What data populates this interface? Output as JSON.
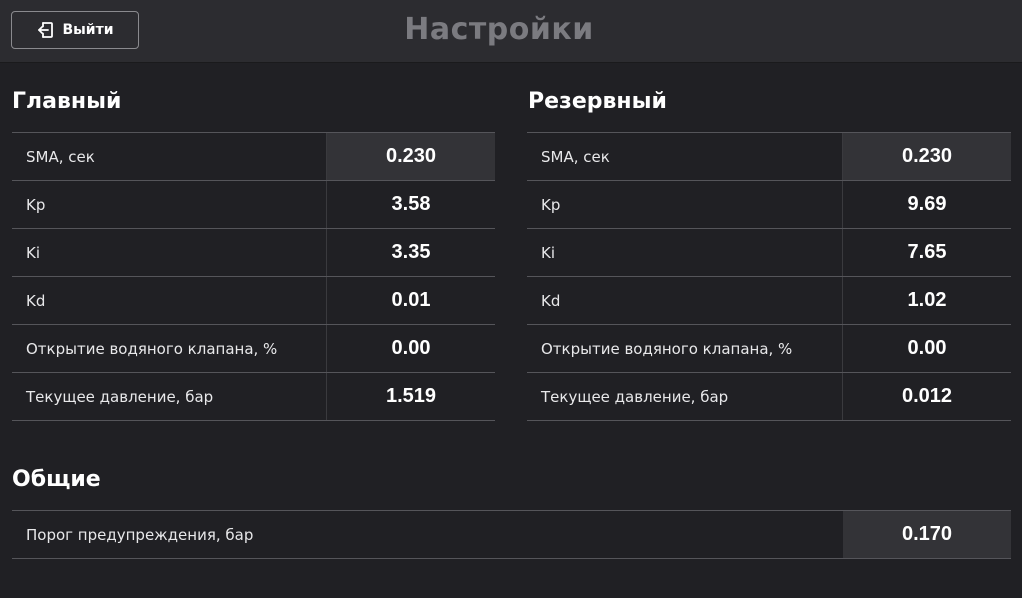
{
  "header": {
    "exit_label": "Выйти",
    "title": "Настройки"
  },
  "main_section": {
    "title": "Главный",
    "rows": [
      {
        "label": "SMA, сек",
        "value": "0.230"
      },
      {
        "label": "Kp",
        "value": "3.58"
      },
      {
        "label": "Ki",
        "value": "3.35"
      },
      {
        "label": "Kd",
        "value": "0.01"
      },
      {
        "label": "Открытие водяного клапана, %",
        "value": "0.00"
      },
      {
        "label": "Текущее давление, бар",
        "value": "1.519"
      }
    ]
  },
  "reserve_section": {
    "title": "Резервный",
    "rows": [
      {
        "label": "SMA, сек",
        "value": "0.230"
      },
      {
        "label": "Kp",
        "value": "9.69"
      },
      {
        "label": "Ki",
        "value": "7.65"
      },
      {
        "label": "Kd",
        "value": "1.02"
      },
      {
        "label": "Открытие водяного клапана, %",
        "value": "0.00"
      },
      {
        "label": "Текущее давление, бар",
        "value": "0.012"
      }
    ]
  },
  "general_section": {
    "title": "Общие",
    "rows": [
      {
        "label": "Порог предупреждения, бар",
        "value": "0.170"
      }
    ]
  },
  "icons": {
    "exit": "logout-icon"
  }
}
